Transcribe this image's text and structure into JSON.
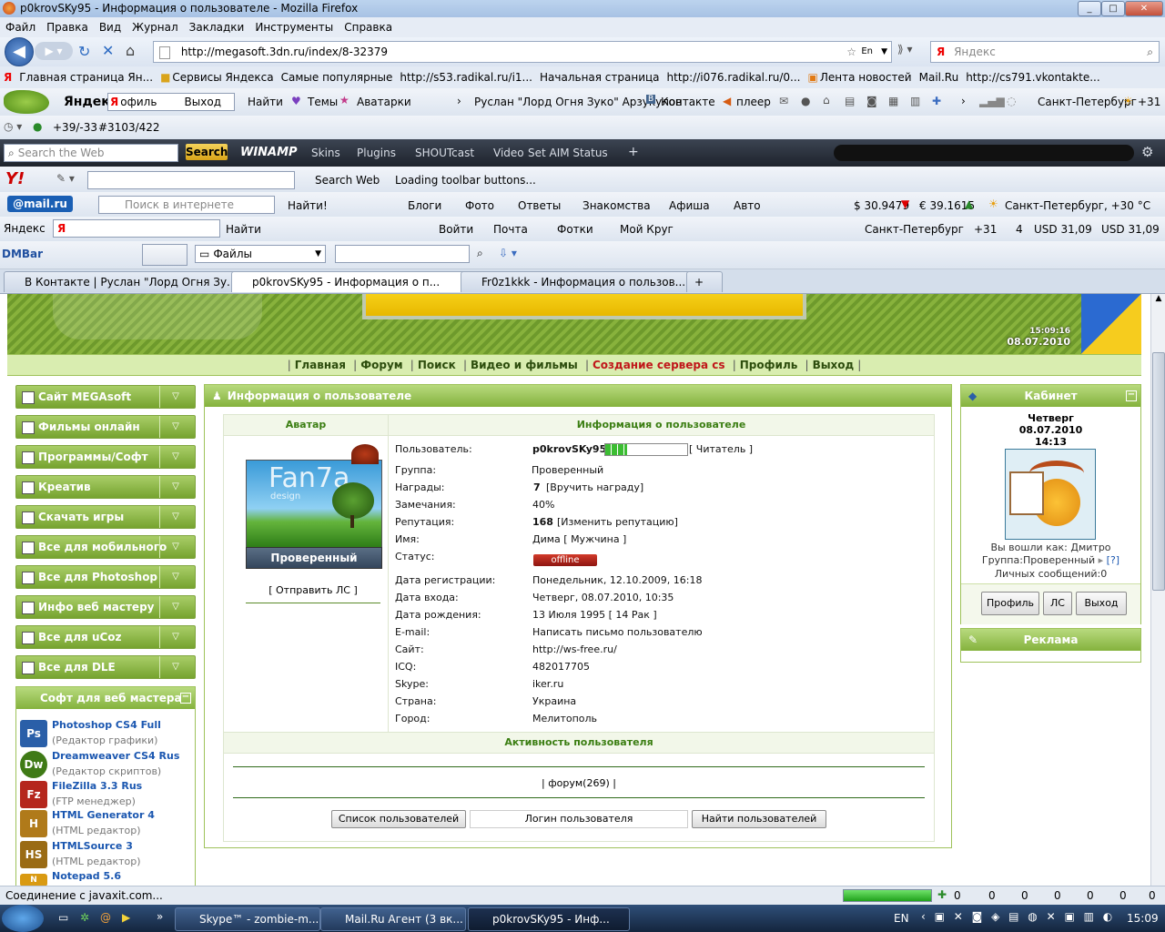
{
  "window": {
    "title": "p0krovSKy95 - Информация о пользователе - Mozilla Firefox",
    "min": "_",
    "max": "□",
    "close": "✕"
  },
  "menu": [
    "Файл",
    "Правка",
    "Вид",
    "Журнал",
    "Закладки",
    "Инструменты",
    "Справка"
  ],
  "nav": {
    "url": "http://megasoft.3dn.ru/index/8-32379",
    "search_placeholder": "Яндекс",
    "lang_badge": "En"
  },
  "bookmarks": [
    "Главная страница Ян...",
    "Сервисы Яндекса",
    "Самые популярные",
    "http://s53.radikal.ru/i1...",
    "Начальная страница",
    "http://i076.radikal.ru/0...",
    "Лента новостей",
    "Mail.Ru",
    "http://cs791.vkontakte..."
  ],
  "yandex_bar": {
    "brand": "Яндекс",
    "input_text": "офиль",
    "exit": "Выход",
    "find": "Найти",
    "themes": "Темы",
    "avatars": "Аватарки",
    "friend": "Руслан \"Лорд Огня Зуко\" Арзукулов",
    "vk": "Контакте",
    "player": "плеер",
    "city": "Санкт-Петербург",
    "temp": "+31"
  },
  "small_bar": {
    "weather": "+39/-33",
    "counter": "#3103/422"
  },
  "winamp_bar": {
    "search_placeholder": "Search the Web",
    "search_btn": "Search",
    "winamp": "WINAMP",
    "items": [
      "Skins",
      "Plugins",
      "SHOUTcast",
      "Video",
      "Set AIM Status"
    ]
  },
  "yahoo_bar": {
    "search_web": "Search Web",
    "loading": "Loading toolbar buttons..."
  },
  "mailru_bar": {
    "brand": "@mail.ru",
    "placeholder": "Поиск в интернете",
    "find": "Найти!",
    "items": [
      "Блоги",
      "Фото",
      "Ответы",
      "Знакомства",
      "Афиша",
      "Авто"
    ],
    "usd": "$ 30.9479",
    "eur": "€ 39.1615",
    "weather": "Санкт-Петербург, +30 °C"
  },
  "yandex_bar2": {
    "brand": "Яндекс",
    "find": "Найти",
    "login": "Войти",
    "mail": "Почта",
    "photos": "Фотки",
    "circle": "Мой Круг",
    "city": "Санкт-Петербург",
    "temp": "+31",
    "count": "4",
    "usd1": "USD 31,09",
    "usd2": "USD 31,09"
  },
  "dmbar": {
    "brand": "DMBar",
    "files": "Файлы"
  },
  "tabs": [
    {
      "label": "В Контакте | Руслан \"Лорд Огня Зу...",
      "active": false
    },
    {
      "label": "p0krovSKy95 - Информация о п...",
      "active": true
    },
    {
      "label": "Fr0z1kkk - Информация о пользов...",
      "active": false
    }
  ],
  "site": {
    "time": "15:09:16",
    "date": "08.07.2010",
    "nav": [
      {
        "label": "Главная",
        "red": false
      },
      {
        "label": "Форум",
        "red": false
      },
      {
        "label": "Поиск",
        "red": false
      },
      {
        "label": "Видео и фильмы",
        "red": false
      },
      {
        "label": "Создание сервера cs",
        "red": true
      },
      {
        "label": "Профиль",
        "red": false
      },
      {
        "label": "Выход",
        "red": false
      }
    ],
    "left_menu": [
      "Сайт MEGAsoft",
      "Фильмы онлайн",
      "Программы/Софт",
      "Креатив",
      "Скачать игры",
      "Все для мобильного",
      "Все для Photoshop",
      "Инфо веб мастеру",
      "Все для uCoz",
      "Все для DLE"
    ],
    "soft_title": "Софт для веб мастера",
    "soft_items": [
      {
        "name": "Photoshop CS4 Full",
        "desc": "(Редактор графики)",
        "icon": "Ps",
        "color": "#2a5fa8"
      },
      {
        "name": "Dreamweaver CS4 Rus",
        "desc": "(Редактор скриптов)",
        "icon": "Dw",
        "color": "#3f7a16"
      },
      {
        "name": "FileZilla 3.3 Rus",
        "desc": "(FTP менеджер)",
        "icon": "Fz",
        "color": "#b5271d"
      },
      {
        "name": "HTML Generator 4",
        "desc": "(HTML редактор)",
        "icon": "H",
        "color": "#b07a1a"
      },
      {
        "name": "HTMLSource 3",
        "desc": "(HTML редактор)",
        "icon": "HS",
        "color": "#9a6b14"
      },
      {
        "name": "Notepad 5.6",
        "desc": "",
        "icon": "N",
        "color": "#d99a12"
      }
    ],
    "main_title": "Информация о пользователе",
    "avatar_col": "Аватар",
    "info_col": "Информация о пользователе",
    "avatar_text": "Fan7a",
    "avatar_sub": "design",
    "rank": "Проверенный",
    "send_pm": "[ Отправить ЛС ]",
    "fields": [
      {
        "label": "Пользователь:",
        "value": "p0krovSKy95",
        "extra": "[ Читатель ]"
      },
      {
        "label": "Группа:",
        "value": "Проверенный",
        "extra": ""
      },
      {
        "label": "Награды:",
        "value": "7",
        "extra": "[Вручить награду]"
      },
      {
        "label": "Замечания:",
        "value": "40%",
        "extra": ""
      },
      {
        "label": "Репутация:",
        "value": "168",
        "extra": "[Изменить репутацию]"
      },
      {
        "label": "Имя:",
        "value": "Дима [ Мужчина ]",
        "extra": ""
      },
      {
        "label": "Статус:",
        "value": "offline",
        "extra": ""
      },
      {
        "label": "Дата регистрации:",
        "value": "Понедельник, 12.10.2009, 16:18",
        "extra": ""
      },
      {
        "label": "Дата входа:",
        "value": "Четверг, 08.07.2010, 10:35",
        "extra": ""
      },
      {
        "label": "Дата рождения:",
        "value": "13 Июля 1995 [ 14 Рак ]",
        "extra": ""
      },
      {
        "label": "E-mail:",
        "value": "Написать письмо пользователю",
        "extra": ""
      },
      {
        "label": "Сайт:",
        "value": "http://ws-free.ru/",
        "extra": ""
      },
      {
        "label": "ICQ:",
        "value": "482017705",
        "extra": ""
      },
      {
        "label": "Skype:",
        "value": "iker.ru",
        "extra": ""
      },
      {
        "label": "Страна:",
        "value": "Украина",
        "extra": ""
      },
      {
        "label": "Город:",
        "value": "Мелитополь",
        "extra": ""
      }
    ],
    "activity_title": "Активность пользователя",
    "activity": "| форум(269) |",
    "btn_userlist": "Список пользователей",
    "login_placeholder": "Логин пользователя",
    "btn_find": "Найти пользователей",
    "cabinet": {
      "title": "Кабинет",
      "day": "Четверг",
      "date": "08.07.2010",
      "time": "14:13",
      "logged_as": "Вы вошли как: Дмитро",
      "group": "Группа:Проверенный",
      "help": "[?]",
      "messages": "Личных сообщений:0",
      "btn_profile": "Профиль",
      "btn_pm": "ЛС",
      "btn_exit": "Выход"
    },
    "ad_title": "Реклама"
  },
  "status": {
    "text": "Соединение с javaxit.com...",
    "progress": 1.0,
    "counters": [
      "0",
      "0",
      "0",
      "0",
      "0",
      "0",
      "0"
    ]
  },
  "taskbar": {
    "items": [
      {
        "label": "Skype™ - zombie-m...",
        "active": false
      },
      {
        "label": "Mail.Ru Агент (3 вк...",
        "active": false
      },
      {
        "label": "p0krovSKy95 - Инф...",
        "active": true
      }
    ],
    "lang": "EN",
    "clock": "15:09"
  }
}
